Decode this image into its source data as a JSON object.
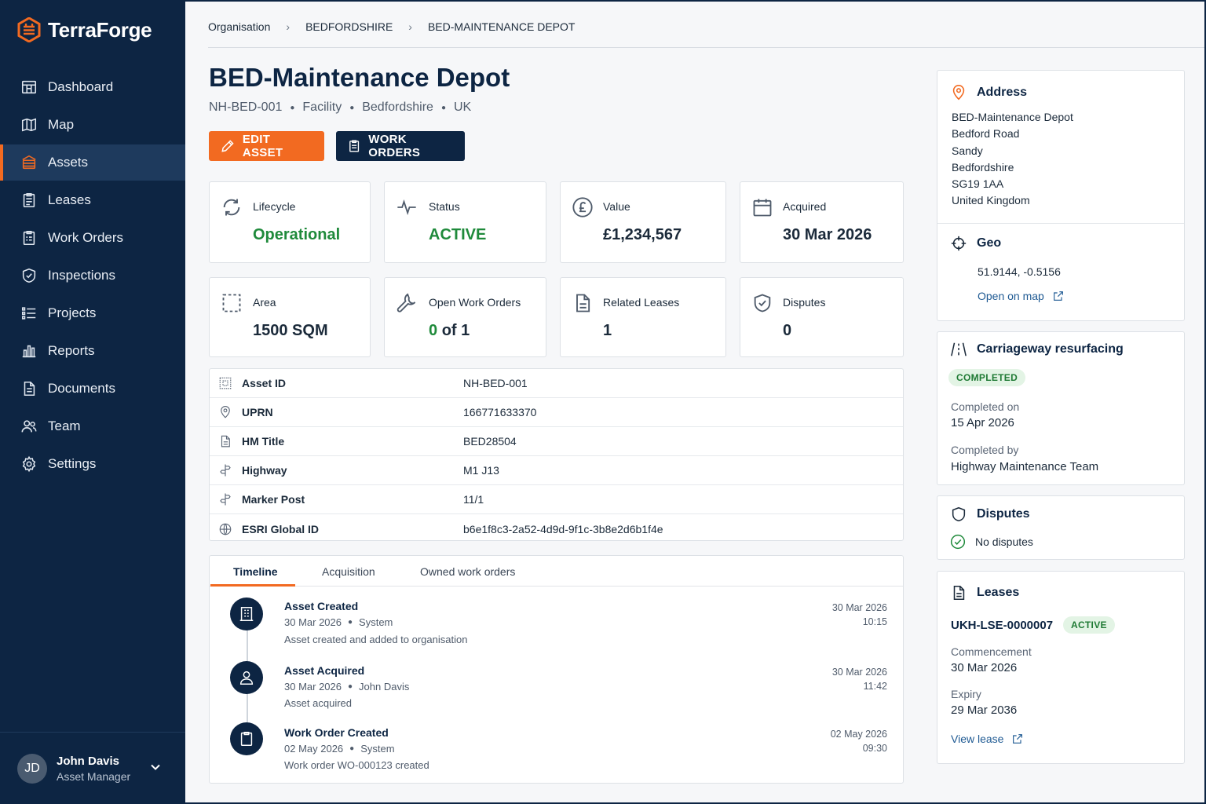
{
  "brand": {
    "name": "TerraForge"
  },
  "nav": [
    {
      "label": "Dashboard",
      "icon": "dashboard-icon"
    },
    {
      "label": "Map",
      "icon": "map-icon"
    },
    {
      "label": "Assets",
      "icon": "assets-icon",
      "active": true
    },
    {
      "label": "Leases",
      "icon": "leases-icon"
    },
    {
      "label": "Work Orders",
      "icon": "work-orders-icon"
    },
    {
      "label": "Inspections",
      "icon": "shield-icon"
    },
    {
      "label": "Projects",
      "icon": "list-icon"
    },
    {
      "label": "Reports",
      "icon": "chart-icon"
    },
    {
      "label": "Documents",
      "icon": "document-icon"
    },
    {
      "label": "Team",
      "icon": "team-icon"
    },
    {
      "label": "Settings",
      "icon": "gear-icon"
    }
  ],
  "user": {
    "initials": "JD",
    "name": "John Davis",
    "role": "Asset Manager"
  },
  "breadcrumb": [
    "Organisation",
    "BEDFORDSHIRE",
    "BED-MAINTENANCE DEPOT"
  ],
  "asset": {
    "title": "BED-Maintenance Depot",
    "subtitle": [
      "NH-BED-001",
      "Facility",
      "Bedfordshire",
      "UK"
    ]
  },
  "actions": {
    "edit": "EDIT ASSET",
    "work_orders": "WORK ORDERS"
  },
  "stats": {
    "lifecycle": {
      "label": "Lifecycle",
      "value": "Operational"
    },
    "status": {
      "label": "Status",
      "value": "ACTIVE"
    },
    "value": {
      "label": "Value",
      "value": "£1,234,567"
    },
    "acquired": {
      "label": "Acquired",
      "value": "30 Mar 2026"
    },
    "area": {
      "label": "Area",
      "value": "1500 SQM"
    },
    "open_work_orders": {
      "label": "Open Work Orders",
      "open": "0",
      "of_text": "of 1"
    },
    "related_leases": {
      "label": "Related Leases",
      "value": "1"
    },
    "disputes": {
      "label": "Disputes",
      "value": "0"
    }
  },
  "details": [
    {
      "key": "Asset ID",
      "value": "NH-BED-001",
      "icon": "id-icon"
    },
    {
      "key": "UPRN",
      "value": "166771633370",
      "icon": "pin-icon"
    },
    {
      "key": "HM Title",
      "value": "BED28504",
      "icon": "document-icon"
    },
    {
      "key": "Highway",
      "value": "M1 J13",
      "icon": "signpost-icon"
    },
    {
      "key": "Marker Post",
      "value": "11/1",
      "icon": "signpost-icon"
    },
    {
      "key": "ESRI Global ID",
      "value": "b6e1f8c3-2a52-4d9d-9f1c-3b8e2d6b1f4e",
      "icon": "globe-icon"
    }
  ],
  "tabs": [
    "Timeline",
    "Acquisition",
    "Owned work orders"
  ],
  "timeline": [
    {
      "title": "Asset Created",
      "date": "30 Mar 2026",
      "actor": "System",
      "desc": "Asset created and added to organisation",
      "ts_date": "30 Mar 2026",
      "ts_time": "10:15",
      "icon": "building-icon"
    },
    {
      "title": "Asset Acquired",
      "date": "30 Mar 2026",
      "actor": "John Davis",
      "desc": "Asset acquired",
      "ts_date": "30 Mar 2026",
      "ts_time": "11:42",
      "icon": "person-icon"
    },
    {
      "title": "Work Order Created",
      "date": "02 May 2026",
      "actor": "System",
      "desc": "Work order WO-000123 created",
      "ts_date": "02 May 2026",
      "ts_time": "09:30",
      "icon": "clipboard-icon"
    }
  ],
  "address": {
    "heading": "Address",
    "lines": [
      "BED-Maintenance Depot",
      "Bedford Road",
      "Sandy",
      "Bedfordshire",
      "SG19 1AA",
      "United Kingdom"
    ]
  },
  "geo": {
    "heading": "Geo",
    "coords": "51.9144, -0.5156",
    "link": "Open on map"
  },
  "project": {
    "heading": "Carriageway resurfacing",
    "badge": "COMPLETED",
    "completed_on_label": "Completed on",
    "completed_on": "15 Apr 2026",
    "completed_by_label": "Completed by",
    "completed_by": "Highway Maintenance Team"
  },
  "disputes_panel": {
    "heading": "Disputes",
    "text": "No disputes"
  },
  "leases_panel": {
    "heading": "Leases",
    "lease_id": "UKH-LSE-0000007",
    "badge": "ACTIVE",
    "commencement_label": "Commencement",
    "commencement": "30 Mar 2026",
    "expiry_label": "Expiry",
    "expiry": "29 Mar 2036",
    "link": "View lease"
  },
  "colors": {
    "navy": "#0d2543",
    "accent": "#f26a21",
    "success": "#1f8a3b"
  }
}
